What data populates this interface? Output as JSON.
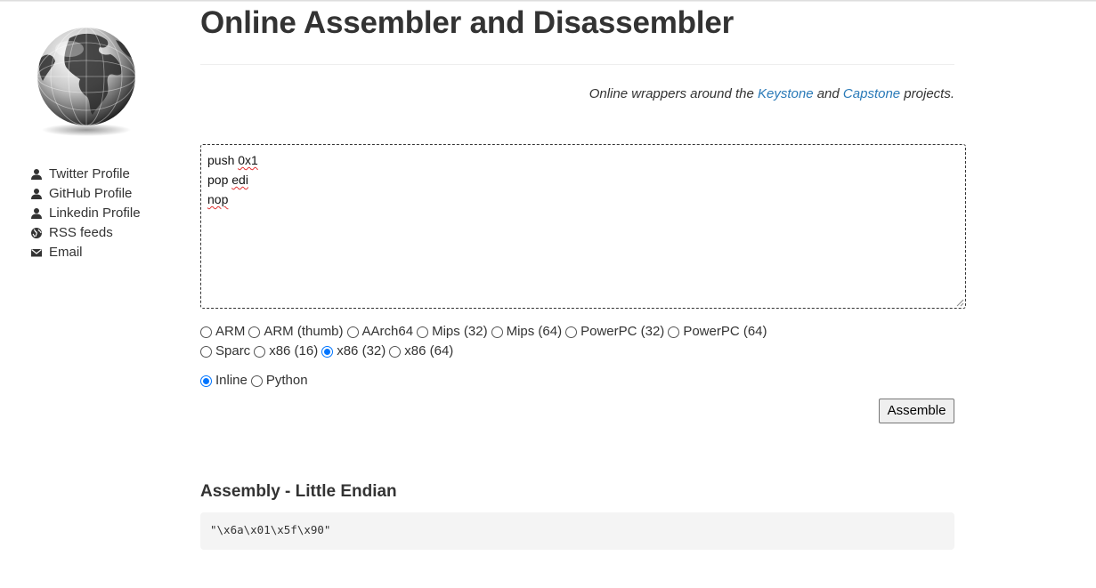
{
  "page": {
    "title": "Online Assembler and Disassembler",
    "tagline": {
      "prefix": "Online wrappers around the ",
      "link1": "Keystone",
      "middle": " and ",
      "link2": "Capstone",
      "suffix": " projects."
    },
    "accent_color": "#2a7ab8"
  },
  "sidebar": {
    "logo_icon": "globe-icon",
    "links": [
      {
        "label": "Twitter Profile",
        "icon": "user-icon"
      },
      {
        "label": "GitHub Profile",
        "icon": "user-icon"
      },
      {
        "label": "Linkedin Profile",
        "icon": "user-icon"
      },
      {
        "label": "RSS feeds",
        "icon": "globe-small-icon"
      },
      {
        "label": "Email",
        "icon": "envelope-icon"
      }
    ]
  },
  "editor": {
    "lines": [
      "push 0x1",
      "pop edi",
      "nop"
    ]
  },
  "architectures": {
    "options": [
      "ARM",
      "ARM (thumb)",
      "AArch64",
      "Mips (32)",
      "Mips (64)",
      "PowerPC (32)",
      "PowerPC (64)",
      "Sparc",
      "x86 (16)",
      "x86 (32)",
      "x86 (64)"
    ],
    "selected": "x86 (32)"
  },
  "output_format": {
    "options": [
      "Inline",
      "Python"
    ],
    "selected": "Inline"
  },
  "assemble_button": "Assemble",
  "result": {
    "heading": "Assembly - Little Endian",
    "code": "\"\\x6a\\x01\\x5f\\x90\""
  }
}
